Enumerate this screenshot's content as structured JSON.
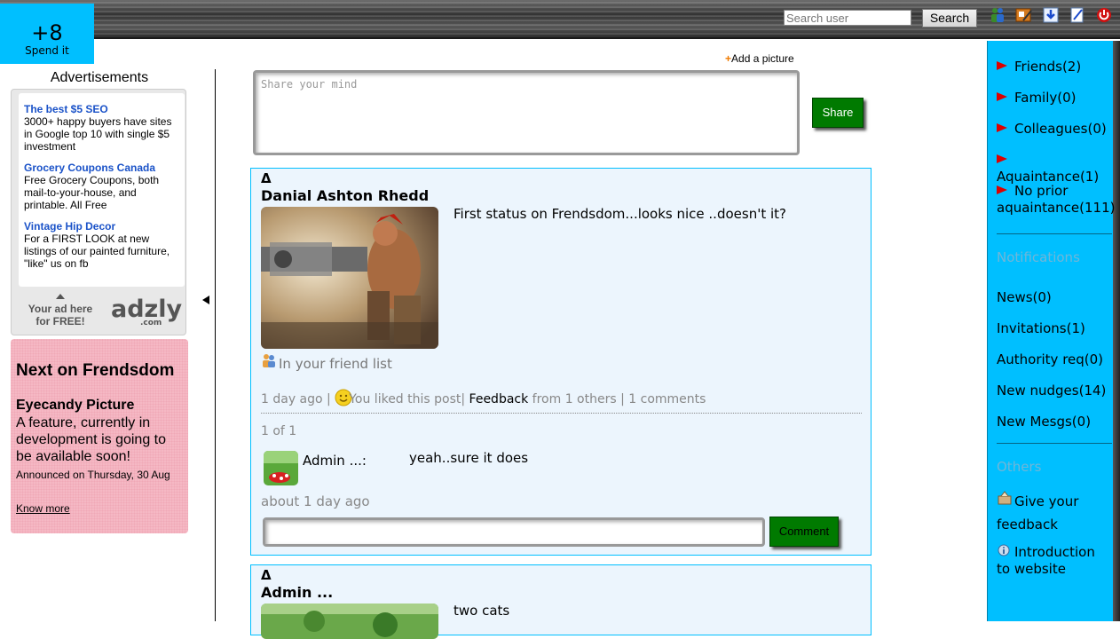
{
  "points": {
    "value": "+8",
    "label": "Spend it"
  },
  "topbar": {
    "search_placeholder": "Search user",
    "search_button": "Search",
    "icons": [
      "people-icon",
      "edit-profile-icon",
      "download-icon",
      "notepad-icon",
      "power-icon"
    ]
  },
  "ads": {
    "title": "Advertisements",
    "items": [
      {
        "title": "The best $5 SEO",
        "text": "3000+ happy buyers have sites in Google top 10 with single $5 investment"
      },
      {
        "title": "Grocery Coupons Canada",
        "text": "Free Grocery Coupons, both mail-to-your-house, and printable. All Free"
      },
      {
        "title": "Vintage Hip Decor",
        "text": "For a FIRST LOOK at new listings of our painted furniture, \"like\" us on fb"
      }
    ],
    "promo": "Your ad here for FREE!",
    "logo": "adzly",
    "logo_domain": ".com"
  },
  "next": {
    "title": "Next on Frendsdom",
    "feature": "Eyecandy Picture",
    "description": "A feature, currently in development is going to be available soon!",
    "announced": "Announced on Thursday, 30 Aug",
    "link": "Know more"
  },
  "composer": {
    "add_picture": "Add a picture",
    "placeholder": "Share your mind",
    "share_button": "Share"
  },
  "posts": [
    {
      "marker": "Δ",
      "author": "Danial Ashton Rhedd",
      "status": "First status on Frendsdom...looks nice ..doesn't it?",
      "relation": "In your friend list",
      "time": "1 day ago",
      "liked": "You liked this post",
      "feedback_label": "Feedback",
      "feedback_from": "from 1 others",
      "comments_count": "1 comments",
      "pager": "1 of 1",
      "comment": {
        "author": "Admin ...:",
        "text": "yeah..sure it does",
        "time": "about 1 day ago"
      },
      "comment_button": "Comment"
    },
    {
      "marker": "Δ",
      "author": "Admin ...",
      "status": "two cats"
    }
  ],
  "sidebar": {
    "groups": [
      {
        "label": "Friends(2)"
      },
      {
        "label": "Family(0)"
      },
      {
        "label": "Colleagues(0)"
      },
      {
        "label": "Aquaintance(1)"
      },
      {
        "label": "No prior aquaintance(111)"
      }
    ],
    "notifications_heading": "Notifications",
    "notifications": [
      {
        "label": "News(0)"
      },
      {
        "label": "Invitations(1)"
      },
      {
        "label": "Authority req(0)"
      },
      {
        "label": "New nudges(14)"
      },
      {
        "label": "New Mesgs(0)"
      }
    ],
    "others_heading": "Others",
    "others": [
      {
        "label": "Give your feedback"
      },
      {
        "label": "Introduction to website"
      }
    ]
  }
}
